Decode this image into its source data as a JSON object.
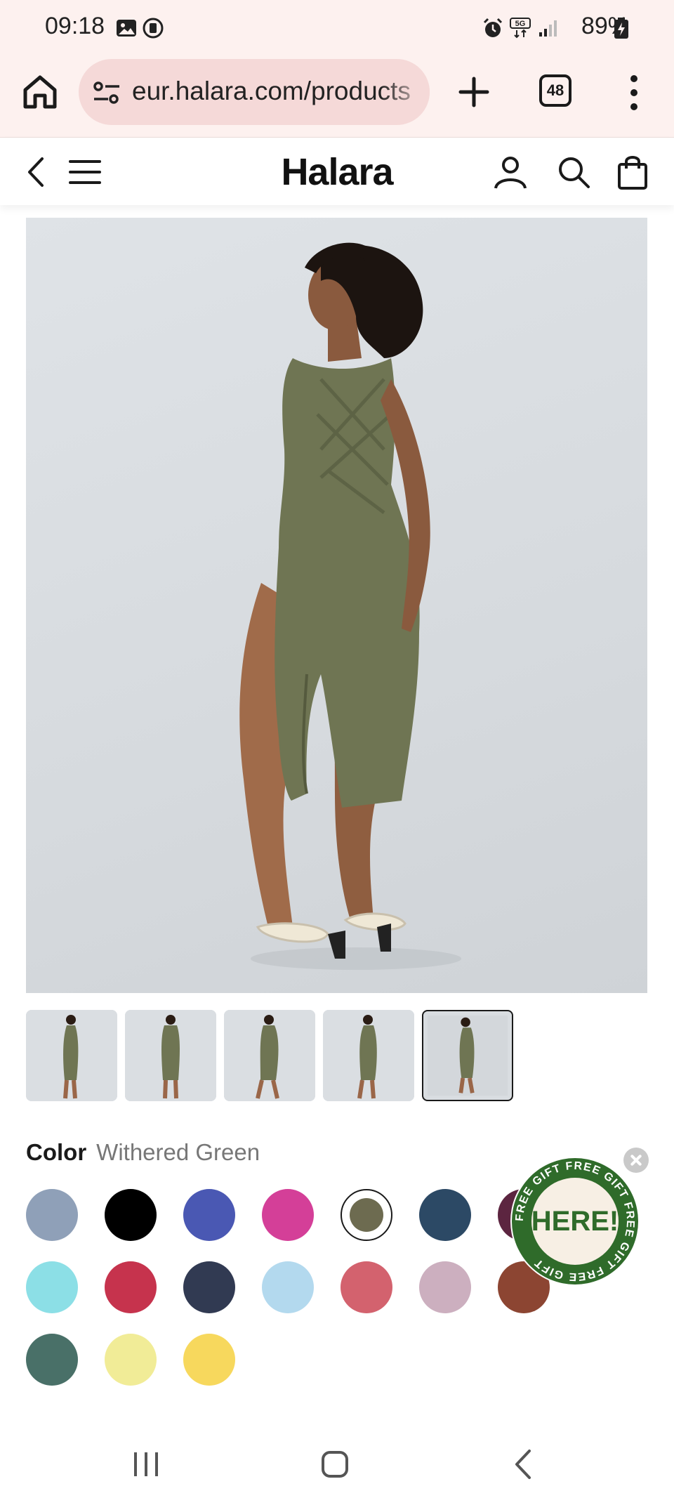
{
  "status_bar": {
    "time": "09:18",
    "battery": "89%",
    "icons": [
      "image-icon",
      "screen-record-icon",
      "alarm-icon",
      "5g-icon",
      "signal-icon",
      "battery-charging-icon"
    ]
  },
  "browser": {
    "url": "eur.halara.com/products",
    "tab_count": "48"
  },
  "site": {
    "logo": "Halara"
  },
  "product": {
    "image_alt": "Model wearing lace-up open back midi dress with side slit",
    "thumbnail_count": 5,
    "selected_thumbnail": 5
  },
  "color": {
    "label": "Color",
    "selected_name": "Withered Green",
    "swatches": [
      {
        "hex": "#8fa0b8"
      },
      {
        "hex": "#000000"
      },
      {
        "hex": "#4a58b3"
      },
      {
        "hex": "#d43f98"
      },
      {
        "hex": "#6d6b50",
        "selected": true
      },
      {
        "hex": "#2c4965"
      },
      {
        "hex": "#5c2540"
      },
      {
        "hex": "#8cdfe6"
      },
      {
        "hex": "#c6334d"
      },
      {
        "hex": "#313a52"
      },
      {
        "hex": "#b3d9ee"
      },
      {
        "hex": "#d3626e"
      },
      {
        "hex": "#ccafbf"
      },
      {
        "hex": "#8c4532"
      },
      {
        "hex": "#497068"
      },
      {
        "hex": "#f1ec97"
      },
      {
        "hex": "#f7d85d"
      }
    ]
  },
  "gift_badge": {
    "ring_text": "FREE GIFT FREE GIFT FREE GIFT FREE GIFT",
    "center_text": "HERE!"
  },
  "colors": {
    "browser_bg": "#fdf1ef",
    "url_pill": "#f5d9d8",
    "gift_green": "#2f6b2a"
  }
}
